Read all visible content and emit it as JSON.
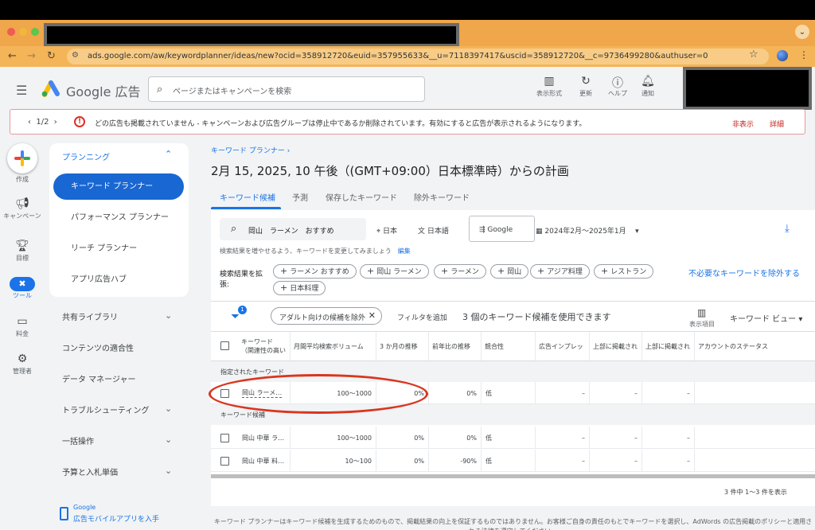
{
  "browser": {
    "url": "ads.google.com/aw/keywordplanner/ideas/new?ocid=358912720&euid=357955633&__u=7118397417&uscid=358912720&__c=9736499280&authuser=0"
  },
  "header": {
    "brand": "Google 広告",
    "search_placeholder": "ページまたはキャンペーンを検索",
    "buttons": [
      {
        "label": "表示形式",
        "icon": "bar-chart-icon"
      },
      {
        "label": "更新",
        "icon": "refresh-icon"
      },
      {
        "label": "ヘルプ",
        "icon": "help-icon"
      },
      {
        "label": "通知",
        "icon": "bell-icon"
      }
    ]
  },
  "alert": {
    "pager": "1/2",
    "message": "どの広告も掲載されていません - キャンペーンおよび広告グループは停止中であるか削除されています。有効にすると広告が表示されるようになります。",
    "dismiss": "非表示",
    "details": "詳細",
    "color": "#d93025"
  },
  "rail": [
    {
      "label": "作成",
      "icon": "create-plus-icon"
    },
    {
      "label": "キャンペーン",
      "icon": "megaphone-icon"
    },
    {
      "label": "目標",
      "icon": "trophy-icon"
    },
    {
      "label": "ツール",
      "icon": "tools-icon"
    },
    {
      "label": "料金",
      "icon": "card-icon"
    },
    {
      "label": "管理者",
      "icon": "gear-icon"
    }
  ],
  "nav": {
    "section": "プランニング",
    "items": [
      "キーワード プランナー",
      "パフォーマンス プランナー",
      "リーチ プランナー",
      "アプリ広告ハブ"
    ],
    "sections": [
      "共有ライブラリ",
      "コンテンツの適合性",
      "データ マネージャー",
      "トラブルシューティング",
      "一括操作",
      "予算と入札単価"
    ],
    "promo_line1": "Google",
    "promo_line2": "広告モバイルアプリを入手"
  },
  "main": {
    "breadcrumb": "キーワード プランナー ›",
    "title": "2月 15, 2025, 10 午後（(GMT+09:00）日本標準時）からの計画",
    "tabs": [
      "キーワード候補",
      "予測",
      "保存したキーワード",
      "除外キーワード"
    ],
    "keyword_input": "岡山　ラーメン　おすすめ",
    "location": "日本",
    "language": "日本語",
    "network": "Google",
    "date_range": "2024年2月～2025年1月",
    "hint": "検索結果を増やせるよう、キーワードを変更してみましょう",
    "hint_edit": "編集",
    "expand_label": "検索結果を拡張:",
    "chips": [
      "ラーメン おすすめ",
      "岡山 ラーメン",
      "ラーメン",
      "岡山",
      "アジア料理",
      "レストラン",
      "日本料理"
    ],
    "exclude_link": "不必要なキーワードを除外する",
    "filter_badge": "1",
    "filter_chip": "アダルト向けの候補を除外",
    "add_filter": "フィルタを追加",
    "available": "3 個のキーワード候補を使用できます",
    "columns_label": "表示項目",
    "view_label": "キーワード ビュー",
    "columns": {
      "keyword_l1": "キーワード",
      "keyword_l2": "（関連性の高い",
      "volume": "月間平均検索ボリューム",
      "three_month": "3 か月の推移",
      "yoy": "前年比の推移",
      "competition": "競合性",
      "impr_share": "広告インプレッ",
      "top_low": "上部に掲載され",
      "top_high": "上部に掲載され",
      "status": "アカウントのステータス"
    },
    "group_specified": "指定されたキーワード",
    "group_ideas": "キーワード候補",
    "specified_rows": [
      {
        "keyword": "岡山 ラーメ…",
        "volume": "100～1000",
        "three_month": "0%",
        "yoy": "0%",
        "competition": "低",
        "impr": "–",
        "low": "–",
        "high": "–"
      }
    ],
    "idea_rows": [
      {
        "keyword": "岡山 中華 ラ…",
        "volume": "100～1000",
        "three_month": "0%",
        "yoy": "0%",
        "competition": "低",
        "impr": "–",
        "low": "–",
        "high": "–"
      },
      {
        "keyword": "岡山 中華 料…",
        "volume": "10～100",
        "three_month": "0%",
        "yoy": "-90%",
        "competition": "低",
        "impr": "–",
        "low": "–",
        "high": "–"
      }
    ],
    "count_text": "3 件中 1～3 件を表示",
    "footer": "キーワード プランナーはキーワード候補を生成するためのもので、掲載結果の向上を保証するものではありません。お客様ご自身の責任のもとでキーワードを選択し、AdWords の広告掲載のポリシーと適用される法律を遵守してください。"
  },
  "annotation_color": "#d9361f"
}
